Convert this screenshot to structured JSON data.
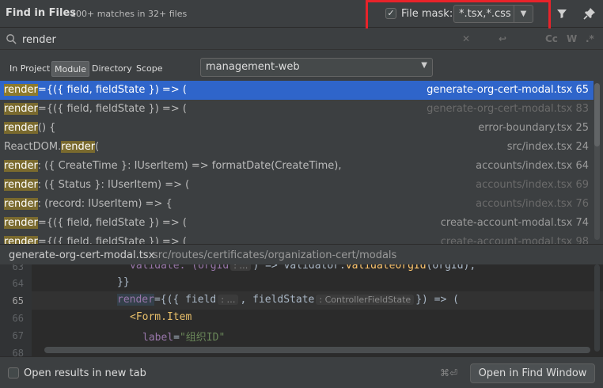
{
  "header": {
    "title": "Find in Files",
    "summary": "100+ matches in 32+ files",
    "file_mask_checked": true,
    "file_mask_label": "File mask:",
    "file_mask_value": "*.tsx,*.css",
    "filter_icon": "filter-icon",
    "pin_icon": "pin-icon"
  },
  "search": {
    "query": "render",
    "options": [
      "Cc",
      "W",
      ".*"
    ]
  },
  "scope": {
    "tabs": [
      {
        "label": "In Project",
        "active": false
      },
      {
        "label": "Module",
        "active": true
      },
      {
        "label": "Directory",
        "active": false
      },
      {
        "label": "Scope",
        "active": false
      }
    ],
    "module_value": "management-web"
  },
  "results": [
    {
      "pre": "",
      "match": "render",
      "post": "={({ field, fieldState }) => (",
      "file": "generate-org-cert-modal.tsx 65",
      "selected": true,
      "dim": false
    },
    {
      "pre": "",
      "match": "render",
      "post": "={({ field, fieldState }) => (",
      "file": "generate-org-cert-modal.tsx 83",
      "selected": false,
      "dim": true
    },
    {
      "pre": "",
      "match": "render",
      "post": "() {",
      "file": "error-boundary.tsx 25",
      "selected": false,
      "dim": false
    },
    {
      "pre": "ReactDOM.",
      "match": "render",
      "post": "(",
      "file": "src/index.tsx 24",
      "selected": false,
      "dim": false
    },
    {
      "pre": "",
      "match": "render",
      "post": ": ({ CreateTime }: IUserItem) => formatDate(CreateTime),",
      "file": "accounts/index.tsx 64",
      "selected": false,
      "dim": false
    },
    {
      "pre": "",
      "match": "render",
      "post": ": ({ Status }: IUserItem) => (",
      "file": "accounts/index.tsx 69",
      "selected": false,
      "dim": true
    },
    {
      "pre": "",
      "match": "render",
      "post": ": (record: IUserItem) => {",
      "file": "accounts/index.tsx 76",
      "selected": false,
      "dim": true
    },
    {
      "pre": "",
      "match": "render",
      "post": "={({ field, fieldState }) => (",
      "file": "create-account-modal.tsx 74",
      "selected": false,
      "dim": false
    },
    {
      "pre": "",
      "match": "render",
      "post": "={({ field, fieldState }) => (",
      "file": "create-account-modal.tsx 98",
      "selected": false,
      "dim": true
    }
  ],
  "preview": {
    "file": "generate-org-cert-modal.tsx",
    "path": "src/routes/certificates/organization-cert/modals",
    "lines": [
      {
        "num": "63",
        "current": false
      },
      {
        "num": "64",
        "current": false
      },
      {
        "num": "65",
        "current": true
      },
      {
        "num": "66",
        "current": false
      },
      {
        "num": "67",
        "current": false
      },
      {
        "num": "68",
        "current": false
      }
    ],
    "code": {
      "l63_a": "validate: (orgId",
      "l63_hint": ": …",
      "l63_b": ") => validator.",
      "l63_fn": "validateOrgId",
      "l63_c": "(orgId),",
      "l64": "}}",
      "l65_kw": "render",
      "l65_a": "={({ field",
      "l65_hint1": ": …",
      "l65_b": ", fieldState",
      "l65_hint2": ": ControllerFieldState",
      "l65_c": "}) => (",
      "l66_tag": "<Form.Item",
      "l67_attr": "label",
      "l67_eq": "=",
      "l67_str": "\"组织ID\""
    }
  },
  "footer": {
    "open_new_tab_label": "Open results in new tab",
    "open_new_tab_checked": false,
    "shortcut": "⌘⏎",
    "open_button_label": "Open in Find Window"
  },
  "colors": {
    "selection": "#2f65ca",
    "highlight": "#7a6a2e",
    "mask_outline": "#e8232a"
  }
}
